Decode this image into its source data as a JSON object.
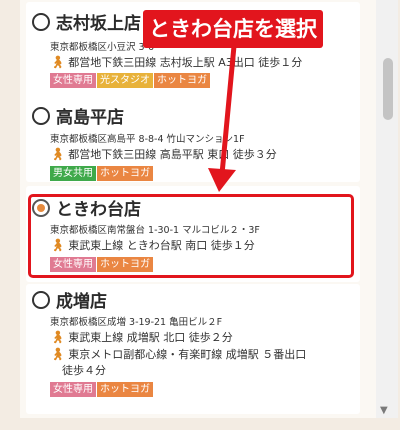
{
  "callout": {
    "text": "ときわ台店を選択"
  },
  "stores": [
    {
      "name": "志村坂上店",
      "address": "東京都板橋区小豆沢 3-6",
      "access": [
        "都営地下鉄三田線 志村坂上駅 A3出口 徒歩１分"
      ],
      "tags": [
        "女性専用",
        "光スタジオ",
        "ホットヨガ"
      ],
      "selected": false
    },
    {
      "name": "高島平店",
      "address": "東京都板橋区高島平 8-8-4 竹山マンション1F",
      "access": [
        "都営地下鉄三田線 高島平駅 東口 徒歩３分"
      ],
      "tags": [
        "男女共用",
        "ホットヨガ"
      ],
      "selected": false
    },
    {
      "name": "ときわ台店",
      "address": "東京都板橋区南常盤台 1-30-1 マルコビル２・3F",
      "access": [
        "東武東上線 ときわ台駅 南口 徒歩１分"
      ],
      "tags": [
        "女性専用",
        "ホットヨガ"
      ],
      "selected": true
    },
    {
      "name": "成増店",
      "address": "東京都板橋区成増 3-19-21 亀田ビル２F",
      "access": [
        "東武東上線 成増駅 北口 徒歩２分",
        "東京メトロ副都心線・有楽町線 成増駅 ５番出口",
        "徒歩４分"
      ],
      "tags": [
        "女性専用",
        "ホットヨガ"
      ],
      "selected": false
    }
  ],
  "colors": {
    "accent_red": "#e2151d",
    "tag_women": "#e07a92",
    "tag_light": "#e8b23a",
    "tag_hotyoga": "#ea8642",
    "tag_mixed": "#3fa94a"
  },
  "icons": {
    "access": "walking-person-icon",
    "scroll_down": "chevron-down-icon"
  }
}
